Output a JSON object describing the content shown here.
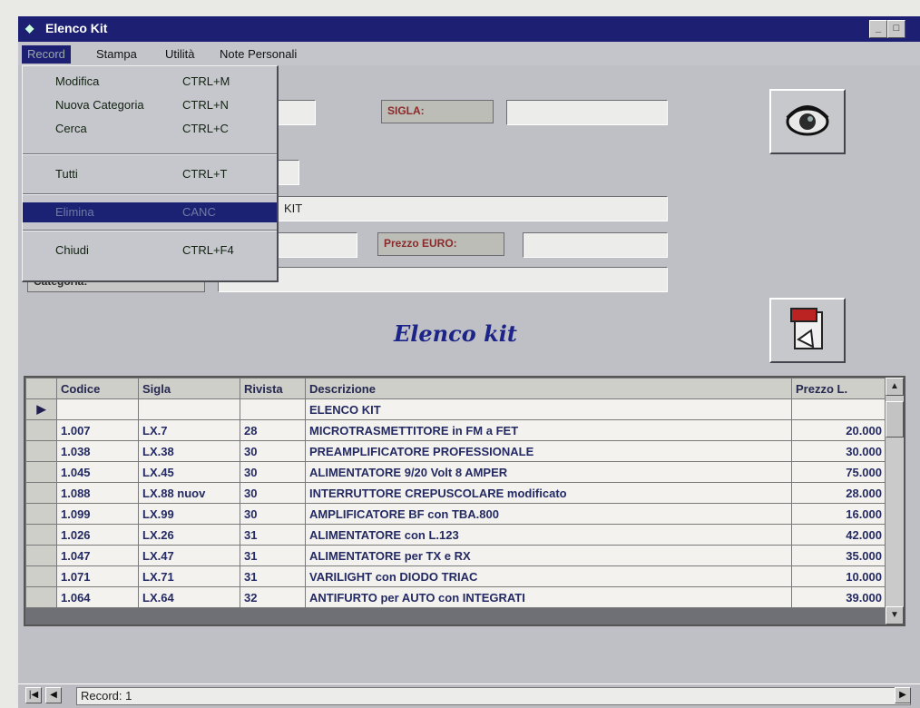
{
  "window": {
    "title": "Elenco Kit"
  },
  "menubar": {
    "items": [
      "Record",
      "Stampa",
      "Utilità",
      "Note Personali"
    ]
  },
  "dropdown": {
    "items": [
      {
        "label": "Modifica",
        "shortcut": "CTRL+M"
      },
      {
        "label": "Nuova Categoria",
        "shortcut": "CTRL+N"
      },
      {
        "label": "Cerca",
        "shortcut": "CTRL+C"
      },
      {
        "label": "Tutti",
        "shortcut": "CTRL+T"
      },
      {
        "label": "Elimina",
        "shortcut": "CANC"
      },
      {
        "label": "Chiudi",
        "shortcut": "CTRL+F4"
      }
    ]
  },
  "form": {
    "sigla_label": "SIGLA:",
    "sigla_value": "",
    "descrizione_value": "KIT",
    "prezzo_euro_label": "Prezzo EURO:",
    "prezzo_euro_value": "",
    "categoria_label": "Categoria:",
    "categoria_value": ""
  },
  "heading": "Elenco kit",
  "table": {
    "columns": [
      "Codice",
      "Sigla",
      "Rivista",
      "Descrizione",
      "Prezzo L."
    ],
    "rows": [
      [
        "",
        "",
        "",
        "ELENCO KIT",
        ""
      ],
      [
        "1.007",
        "LX.7",
        "28",
        "MICROTRASMETTITORE in FM a FET",
        "20.000"
      ],
      [
        "1.038",
        "LX.38",
        "30",
        "PREAMPLIFICATORE PROFESSIONALE",
        "30.000"
      ],
      [
        "1.045",
        "LX.45",
        "30",
        "ALIMENTATORE 9/20 Volt 8 AMPER",
        "75.000"
      ],
      [
        "1.088",
        "LX.88 nuov",
        "30",
        "INTERRUTTORE CREPUSCOLARE modificato",
        "28.000"
      ],
      [
        "1.099",
        "LX.99",
        "30",
        "AMPLIFICATORE BF con TBA.800",
        "16.000"
      ],
      [
        "1.026",
        "LX.26",
        "31",
        "ALIMENTATORE con L.123",
        "42.000"
      ],
      [
        "1.047",
        "LX.47",
        "31",
        "ALIMENTATORE per TX e RX",
        "35.000"
      ],
      [
        "1.071",
        "LX.71",
        "31",
        "VARILIGHT con DIODO TRIAC",
        "10.000"
      ],
      [
        "1.064",
        "LX.64",
        "32",
        "ANTIFURTO per AUTO con INTEGRATI",
        "39.000"
      ]
    ]
  },
  "statusbar": {
    "record_label": "Record: 1"
  }
}
